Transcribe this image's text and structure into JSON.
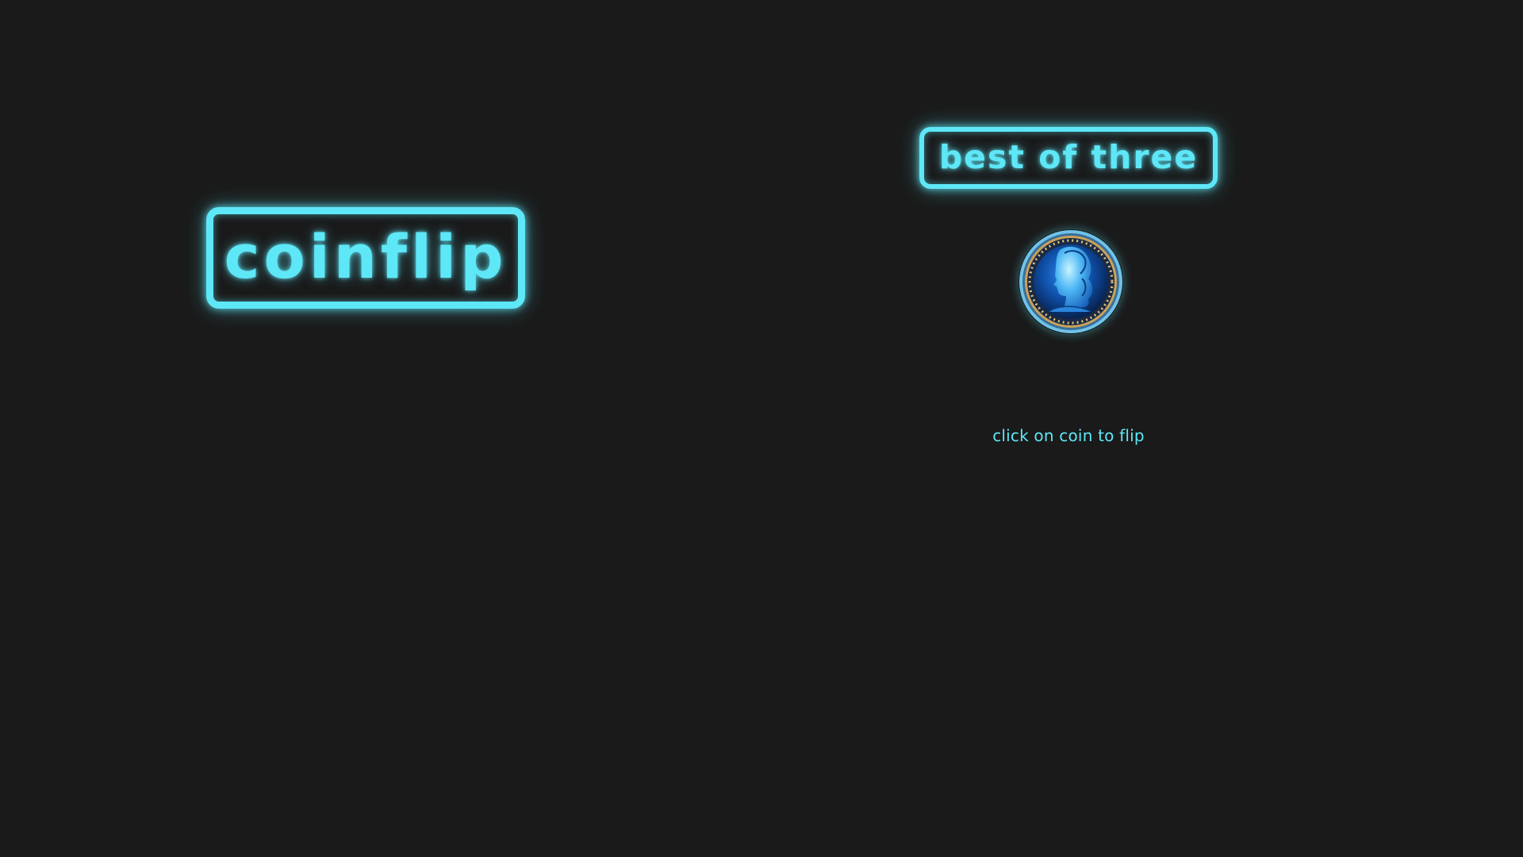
{
  "app": {
    "logo_text": "coinflip"
  },
  "mode": {
    "label": "best of three"
  },
  "coin": {
    "icon": "coin-portrait-icon",
    "hint": "click on coin to flip"
  },
  "colors": {
    "background": "#1a1a1a",
    "neon": "#5ee7f7",
    "coin_rim": "#c9a25a",
    "coin_face": "#0d3f86"
  }
}
